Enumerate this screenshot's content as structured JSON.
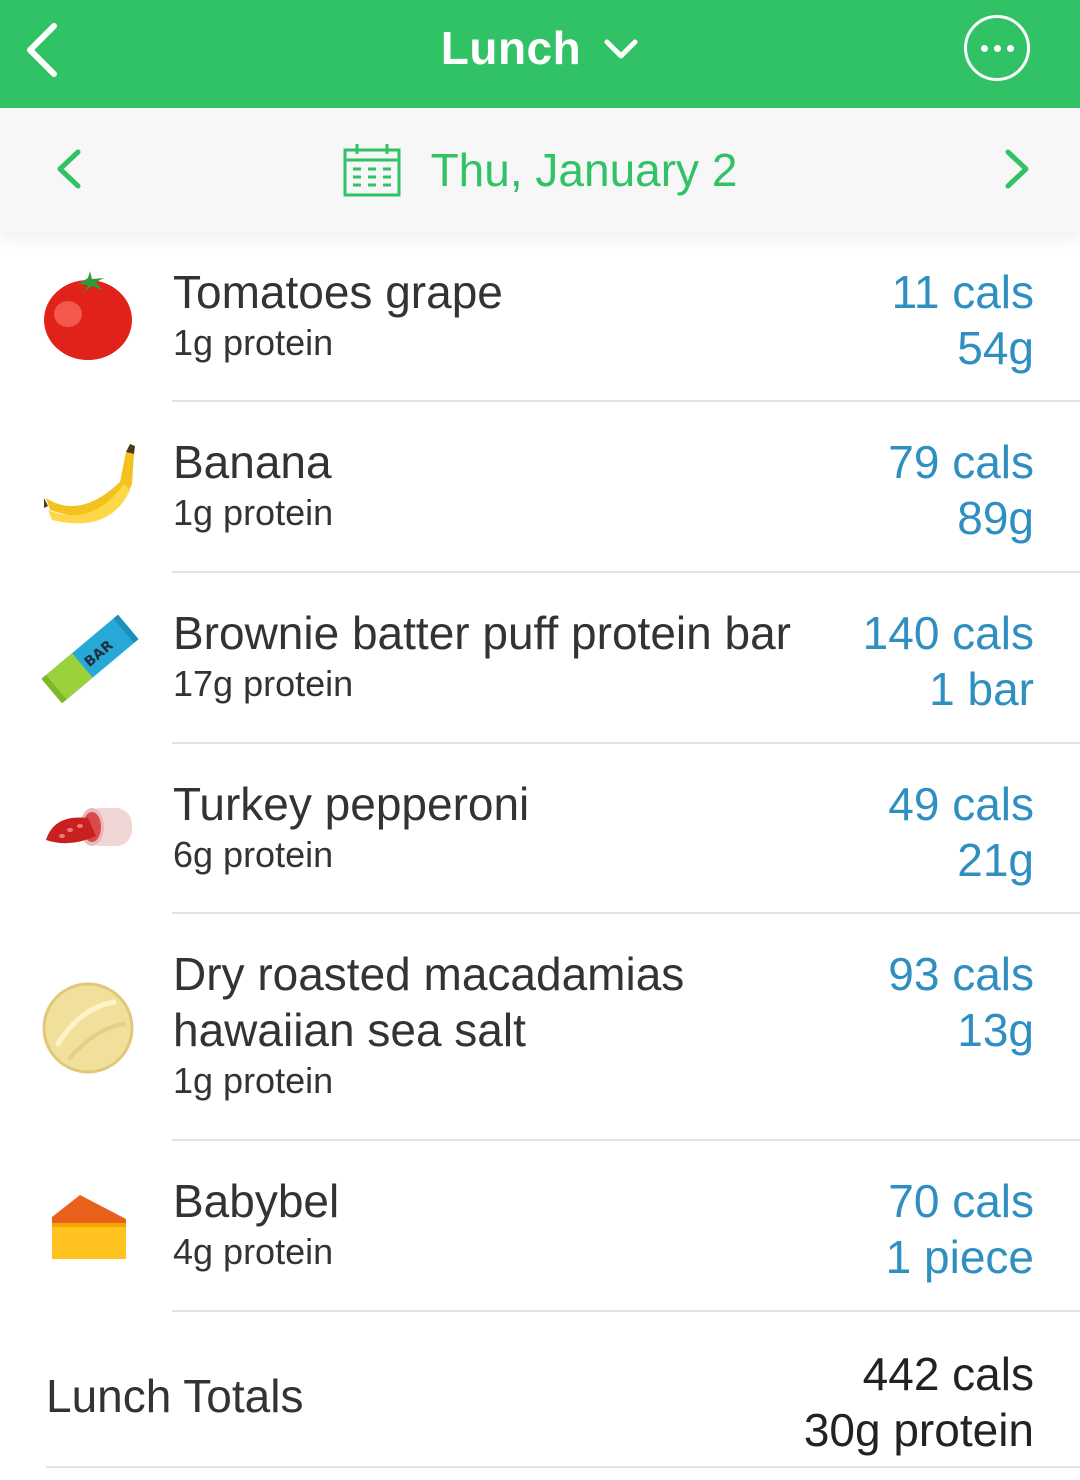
{
  "header": {
    "title": "Lunch",
    "back_icon": "chevron-left-icon",
    "dropdown_icon": "chevron-down-icon",
    "more_icon": "ellipsis-icon",
    "accent_color": "#31c266"
  },
  "datebar": {
    "date": "Thu, January 2",
    "calendar_icon": "calendar-icon",
    "prev_icon": "chevron-left-icon",
    "next_icon": "chevron-right-icon"
  },
  "foods": [
    {
      "name": "Tomatoes grape",
      "protein": "1g protein",
      "cals": "11 cals",
      "amount": "54g",
      "icon": "tomato-icon"
    },
    {
      "name": "Banana",
      "protein": "1g protein",
      "cals": "79 cals",
      "amount": "89g",
      "icon": "banana-icon"
    },
    {
      "name": "Brownie batter puff protein bar",
      "protein": "17g protein",
      "cals": "140 cals",
      "amount": "1 bar",
      "icon": "protein-bar-icon",
      "icon_label": "BAR"
    },
    {
      "name": "Turkey pepperoni",
      "protein": "6g protein",
      "cals": "49 cals",
      "amount": "21g",
      "icon": "pepperoni-icon"
    },
    {
      "name": "Dry roasted macadamias hawaiian sea salt",
      "name_line1": "Dry roasted macadamias",
      "name_line2": "hawaiian sea salt",
      "protein": "1g protein",
      "cals": "93 cals",
      "amount": "13g",
      "icon": "macadamia-nut-icon"
    },
    {
      "name": "Babybel",
      "protein": "4g protein",
      "cals": "70 cals",
      "amount": "1 piece",
      "icon": "cheese-icon"
    }
  ],
  "totals": {
    "label": "Lunch Totals",
    "cals": "442 cals",
    "protein": "30g protein"
  }
}
